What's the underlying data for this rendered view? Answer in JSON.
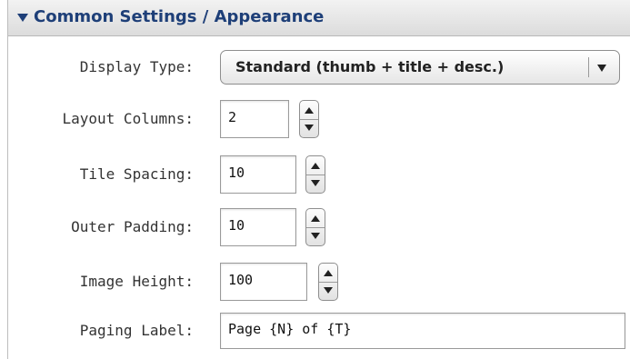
{
  "section": {
    "title": "Common Settings / Appearance",
    "expanded": true,
    "accent_color": "#1e3f78"
  },
  "fields": {
    "display_type": {
      "label": "Display Type:",
      "value": "Standard (thumb + title + desc.)"
    },
    "layout_columns": {
      "label": "Layout Columns:",
      "value": "2"
    },
    "tile_spacing": {
      "label": "Tile Spacing:",
      "value": "10"
    },
    "outer_padding": {
      "label": "Outer Padding:",
      "value": "10"
    },
    "image_height": {
      "label": "Image Height:",
      "value": "100"
    },
    "paging_label": {
      "label": "Paging Label:",
      "value": "Page {N} of {T}"
    }
  },
  "icons": {
    "collapse": "triangle-down-icon",
    "select_caret": "chevron-down-icon",
    "stepper": "up-down-stepper-icon"
  }
}
